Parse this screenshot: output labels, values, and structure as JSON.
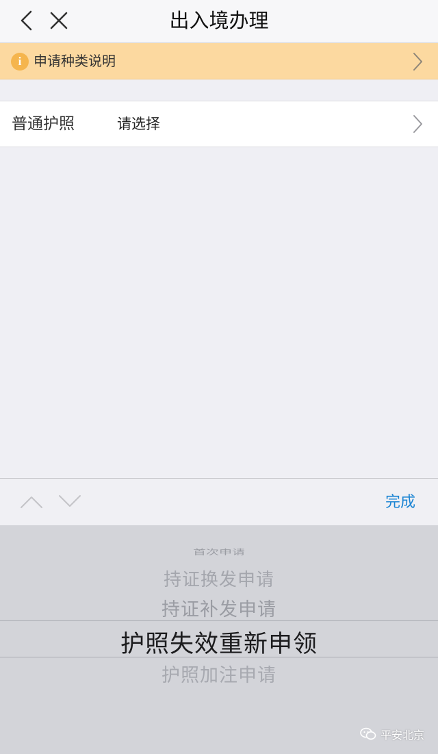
{
  "nav": {
    "title": "出入境办理",
    "back_icon": "chevron-left-icon",
    "close_icon": "close-icon"
  },
  "notice": {
    "icon": "info-icon",
    "icon_glyph": "i",
    "label": "申请种类说明",
    "bg_color": "#fcd9a0"
  },
  "form": {
    "field_label": "普通护照",
    "field_value": "请选择"
  },
  "toolbar": {
    "prev_icon": "chevron-up-icon",
    "next_icon": "chevron-down-icon",
    "done_label": "完成",
    "accent_color": "#1a84d3"
  },
  "picker": {
    "options": [
      "首次申请",
      "持证换发申请",
      "持证补发申请",
      "护照失效重新申领",
      "护照加注申请"
    ],
    "selected": "护照失效重新申领"
  },
  "watermark": {
    "icon": "wechat-icon",
    "text": "平安北京"
  }
}
